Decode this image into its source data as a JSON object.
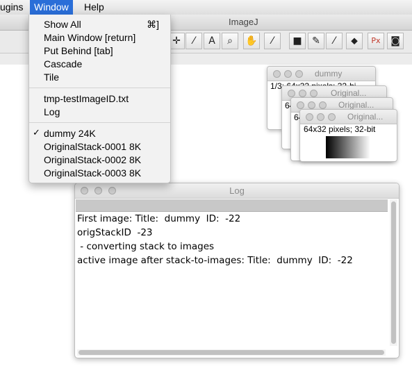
{
  "menubar": {
    "items": [
      {
        "label": "ugins"
      },
      {
        "label": "Window"
      },
      {
        "label": "Help"
      }
    ]
  },
  "imagej": {
    "title": "ImageJ",
    "tools": [
      "crosshair-tool-icon",
      "wand-icon",
      "text-icon",
      "magnifier-icon",
      "hand-icon",
      "dropper-icon",
      "color-swatch-icon",
      "pencil-icon",
      "brush-icon",
      "flood-fill-icon",
      "px-icon",
      "camera-icon"
    ],
    "tool_glyphs": [
      "✛",
      "⁄",
      "A",
      "⌕",
      "✋",
      "⁄",
      "■",
      "✎",
      "⁄",
      "⬥",
      "Px",
      "◙"
    ]
  },
  "image_windows": [
    {
      "title": "dummy",
      "info": "1/3; 64x32 pixels; 32-bi"
    },
    {
      "title": "Original...",
      "info": "64"
    },
    {
      "title": "Original...",
      "info": "64"
    },
    {
      "title": "Original...",
      "info": "64x32 pixels; 32-bit"
    }
  ],
  "log_window": {
    "title": "Log",
    "lines": [
      "First image: Title:  dummy  ID:  -22",
      "origStackID  -23",
      " - converting stack to images",
      "active image after stack-to-images: Title:  dummy  ID:  -22"
    ]
  },
  "window_menu": {
    "show_all": "Show All",
    "show_all_shortcut": "⌘]",
    "main_window": "Main Window [return]",
    "put_behind": "Put Behind [tab]",
    "cascade": "Cascade",
    "tile": "Tile",
    "tmp_file": "tmp-testImageID.txt",
    "log": "Log",
    "check_mark": "✓",
    "dummy": "dummy 24K",
    "stack1": "OriginalStack-0001 8K",
    "stack2": "OriginalStack-0002 8K",
    "stack3": "OriginalStack-0003 8K"
  },
  "colors": {
    "menu_highlight": "#2a6ed8"
  }
}
